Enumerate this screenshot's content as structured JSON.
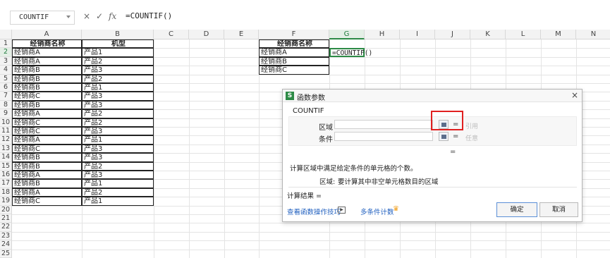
{
  "formula_bar": {
    "name_box": "COUNTIF",
    "cancel_glyph": "×",
    "confirm_glyph": "✓",
    "fx_label": "fx",
    "formula": "=COUNTIF()"
  },
  "columns": [
    "A",
    "B",
    "C",
    "D",
    "E",
    "F",
    "G",
    "H",
    "I",
    "J",
    "K",
    "L",
    "M",
    "N"
  ],
  "rows": [
    "1",
    "2",
    "3",
    "4",
    "5",
    "6",
    "7",
    "8",
    "9",
    "10",
    "11",
    "12",
    "13",
    "14",
    "15",
    "16",
    "17",
    "18",
    "19",
    "20",
    "21",
    "22",
    "23",
    "24",
    "25"
  ],
  "sheet": {
    "table1_headers": [
      "经销商名称",
      "机型"
    ],
    "table1_rows": [
      [
        "经销商A",
        "产品1"
      ],
      [
        "经销商A",
        "产品2"
      ],
      [
        "经销商B",
        "产品3"
      ],
      [
        "经销商B",
        "产品2"
      ],
      [
        "经销商B",
        "产品1"
      ],
      [
        "经销商C",
        "产品3"
      ],
      [
        "经销商B",
        "产品3"
      ],
      [
        "经销商A",
        "产品2"
      ],
      [
        "经销商C",
        "产品2"
      ],
      [
        "经销商C",
        "产品3"
      ],
      [
        "经销商A",
        "产品1"
      ],
      [
        "经销商C",
        "产品3"
      ],
      [
        "经销商B",
        "产品3"
      ],
      [
        "经销商B",
        "产品2"
      ],
      [
        "经销商A",
        "产品3"
      ],
      [
        "经销商B",
        "产品1"
      ],
      [
        "经销商A",
        "产品2"
      ],
      [
        "经销商C",
        "产品1"
      ]
    ],
    "table2_header": "经销商名称",
    "table2_rows": [
      "经销商A",
      "经销商B",
      "经销商C"
    ],
    "active_cell_text": "=COUNTIF()"
  },
  "dialog": {
    "logo": "S",
    "title": "函数参数",
    "close_glyph": "×",
    "function_name": "COUNTIF",
    "arg1_label": "区域",
    "arg1_eq": "=",
    "arg1_hint": "引用",
    "arg2_label": "条件",
    "arg2_eq": "=",
    "arg2_hint": "任意",
    "result_eq": "=",
    "description": "计算区域中满足给定条件的单元格的个数。",
    "arg_desc_label": "区域:",
    "arg_desc_text": "要计算其中非空单元格数目的区域",
    "result_label": "计算结果 =",
    "link_tips": "查看函数操作技巧",
    "link_multi": "多条件计数",
    "ok_label": "确定",
    "cancel_label": "取消",
    "colors": {
      "accent": "#2e8b47",
      "highlight_box": "#e02020",
      "link": "#1f5fbf",
      "crown": "#f0a020"
    }
  }
}
